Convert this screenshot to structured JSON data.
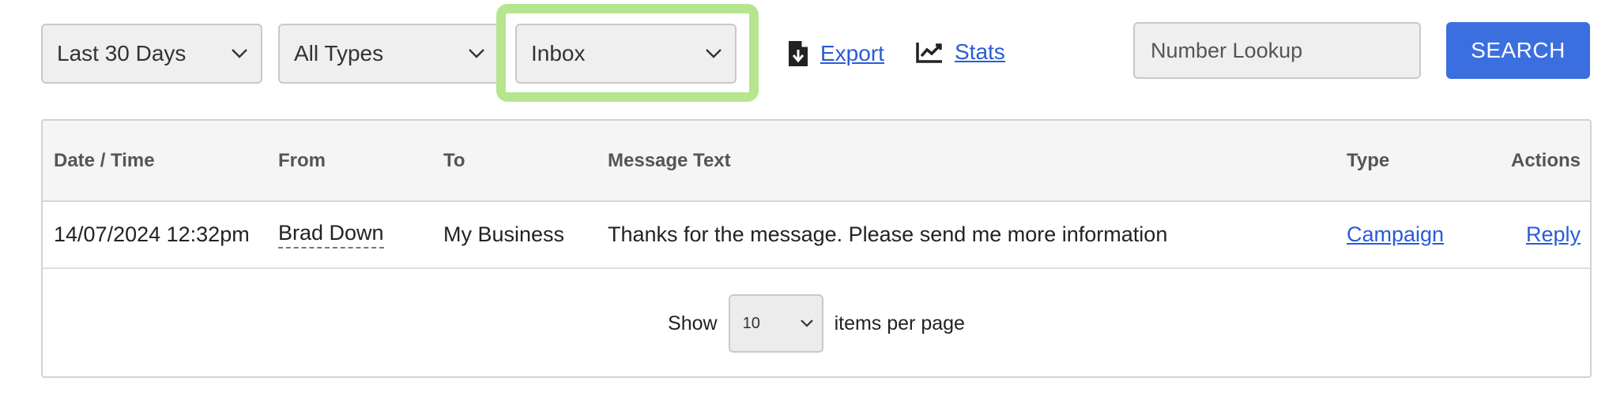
{
  "filters": {
    "date_range": "Last 30 Days",
    "message_type": "All Types",
    "folder": "Inbox"
  },
  "toolbar": {
    "export_label": "Export",
    "stats_label": "Stats"
  },
  "search": {
    "placeholder": "Number Lookup",
    "button_label": "SEARCH"
  },
  "table": {
    "headers": {
      "datetime": "Date / Time",
      "from": "From",
      "to": "To",
      "message": "Message Text",
      "type": "Type",
      "actions": "Actions"
    },
    "rows": [
      {
        "datetime": "14/07/2024 12:32pm",
        "from": "Brad Down",
        "to": "My Business",
        "message": "Thanks for the message. Please send me more information",
        "type": "Campaign",
        "action": "Reply"
      }
    ]
  },
  "pagination": {
    "show_label": "Show",
    "page_size": "10",
    "suffix_label": "items per page"
  },
  "colors": {
    "accent": "#3b6fe0",
    "link": "#2a5bd7",
    "highlight": "#b5e68e"
  }
}
